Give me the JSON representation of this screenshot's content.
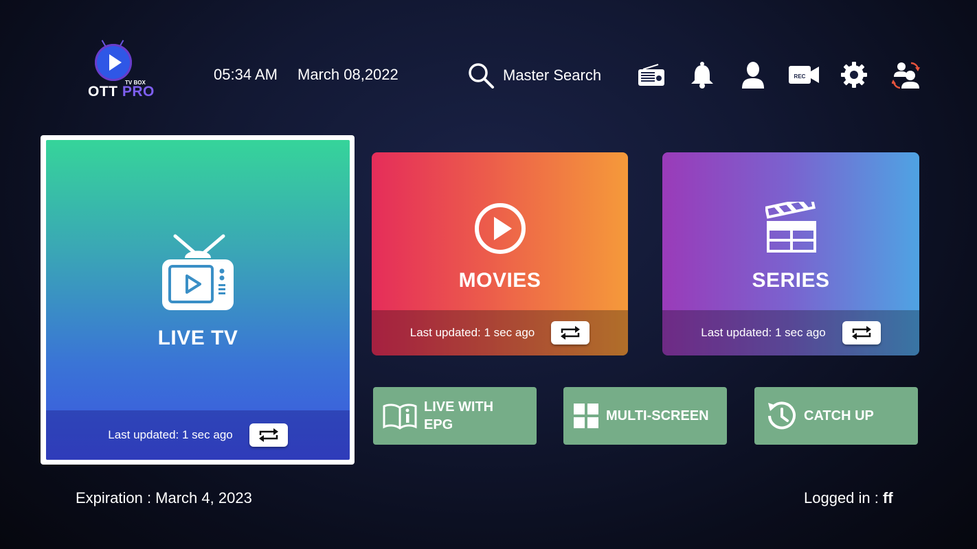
{
  "header": {
    "logo_top": "TV BOX",
    "logo_ott": "OTT",
    "logo_pro": "PRO",
    "time": "05:34 AM",
    "date": "March 08,2022",
    "search_label": "Master Search",
    "icons": [
      "radio-icon",
      "bell-icon",
      "user-icon",
      "rec-camera-icon",
      "gear-icon",
      "switch-user-icon"
    ],
    "rec_text": "REC"
  },
  "tiles": {
    "live_tv": {
      "title": "LIVE TV",
      "updated": "Last updated: 1 sec ago"
    },
    "movies": {
      "title": "MOVIES",
      "updated": "Last updated: 1 sec ago"
    },
    "series": {
      "title": "SERIES",
      "updated": "Last updated: 1 sec ago"
    }
  },
  "shortcuts": {
    "epg_line1": "LIVE WITH",
    "epg_line2": "EPG",
    "multiscreen": "MULTI-SCREEN",
    "catchup": "CATCH UP"
  },
  "footer": {
    "expiration": "Expiration : March 4, 2023",
    "logged_label": "Logged in : ",
    "logged_user": "ff"
  },
  "colors": {
    "shortcut_bg": "#76ad88",
    "movies_start": "#e52d5a",
    "movies_end": "#f59a3a",
    "series_start": "#9a3bb9",
    "series_end": "#4fa3e3",
    "live_top": "#36d49a",
    "live_bottom": "#3c54e0"
  }
}
